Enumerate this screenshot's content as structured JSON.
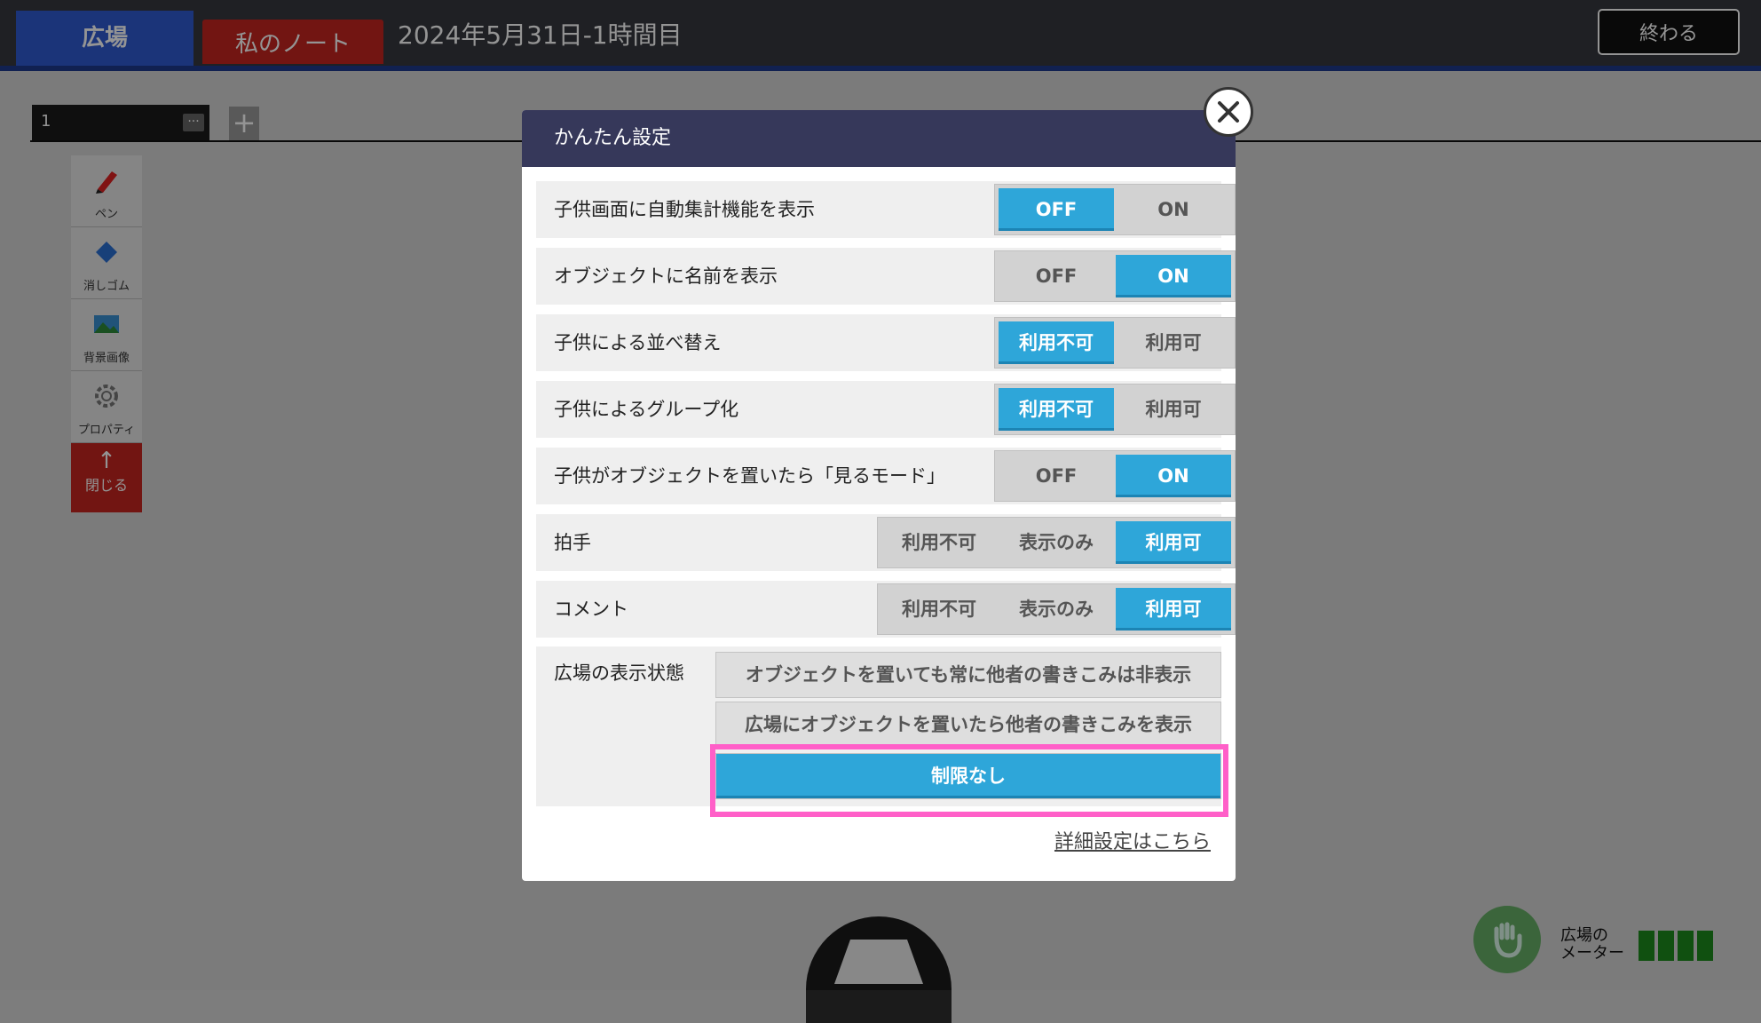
{
  "app": {
    "tabs": {
      "plaza": "広場",
      "my_note": "私のノート"
    },
    "session_title": "2024年5月31日-1時間目",
    "end_button": "終わる"
  },
  "page_tab": {
    "number": "1",
    "menu": "···",
    "add": "+"
  },
  "toolbar": {
    "items": [
      {
        "label": "ペン",
        "icon": "pen-icon"
      },
      {
        "label": "消しゴム",
        "icon": "eraser-icon"
      },
      {
        "label": "背景画像",
        "icon": "background-image-icon"
      },
      {
        "label": "プロパティ",
        "icon": "gear-icon"
      }
    ],
    "close": {
      "arrow": "↑",
      "label": "閉じる"
    }
  },
  "meter": {
    "label_line1": "広場の",
    "label_line2": "メーター",
    "bars": 4
  },
  "modal": {
    "title": "かんたん設定",
    "rows": [
      {
        "label": "子供画面に自動集計機能を表示",
        "options": [
          "OFF",
          "ON"
        ],
        "selected": 0
      },
      {
        "label": "オブジェクトに名前を表示",
        "options": [
          "OFF",
          "ON"
        ],
        "selected": 1
      },
      {
        "label": "子供による並べ替え",
        "options": [
          "利用不可",
          "利用可"
        ],
        "selected": 0
      },
      {
        "label": "子供によるグループ化",
        "options": [
          "利用不可",
          "利用可"
        ],
        "selected": 0
      },
      {
        "label": "子供がオブジェクトを置いたら「見るモード」",
        "options": [
          "OFF",
          "ON"
        ],
        "selected": 1
      },
      {
        "label": "拍手",
        "options": [
          "利用不可",
          "表示のみ",
          "利用可"
        ],
        "selected": 2
      },
      {
        "label": "コメント",
        "options": [
          "利用不可",
          "表示のみ",
          "利用可"
        ],
        "selected": 2
      }
    ],
    "display_state": {
      "label": "広場の表示状態",
      "options": [
        "オブジェクトを置いても常に他者の書きこみは非表示",
        "広場にオブジェクトを置いたら他者の書きこみを表示",
        "制限なし"
      ],
      "selected": 2
    },
    "details_link": "詳細設定はこちら"
  },
  "colors": {
    "accent": "#2ea6d9",
    "highlight": "#ff5fc8",
    "header": "#36385a"
  }
}
